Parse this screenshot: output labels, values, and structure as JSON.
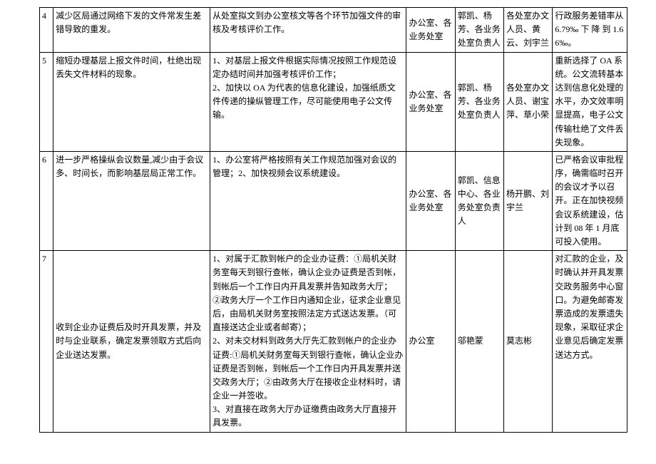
{
  "rows": [
    {
      "num": "4",
      "problem": "减少区局通过网络下发的文件常发生差错导致的重发。",
      "measure": "从处室拟文到办公室核文等各个环节加强文件的审核及考核评价工作。",
      "dept1": "办公室、各业务处室",
      "dept2": "郭凯、杨芳、各业务处室负责人",
      "dept3": "各处室办文人员、黄云、刘宇兰",
      "remark": "行政服务差错率从 6.79‰ 下 降 到 1.66‰。"
    },
    {
      "num": "5",
      "problem": "缩短办理基层上报文件时间，杜绝出现丢失文件材料的现象。",
      "measure": "1、对基层上报文件根据实际情况按照工作规范设定办结时间并加强考核评价工作；\n2、加快以 OA 为代表的信息化建设，加强纸质文件传递的操纵管理工作，尽可能使用电子公文传输。",
      "dept1": "办公室、各业务处室",
      "dept2": "郭凯、杨芳、各业务处室负责人",
      "dept3": "各处室办文人员、谢宝萍、草小荣",
      "remark": "重新选择了 OA 系统。公文流转基本达到信息化处理的水平，办文效率明显提高，电子公文传输杜绝了文件丢失现象。"
    },
    {
      "num": "6",
      "problem": "进一步严格操纵会议数量,减少由于会议多、时间长，而影响基层局正常工作。",
      "measure": "1、办公室将严格按照有关工作规范加强对会议的管理；2、加快视频会议系统建设。",
      "dept1": "办公室、各业务处室",
      "dept2": "郭凯、信息中心、各业务处室负责人",
      "dept3": "杨开鹏、刘宇兰",
      "remark": "已严格会议审批程序，确需临时召开的会议才予以召开。正在加快视频会议系统建设，估计到 08 年 1 月底可投入使用。"
    },
    {
      "num": "7",
      "problem": "收到企业办证费后及时开具发票，并及时与企业联系，确定发票领取方式后向企业送达发票。",
      "measure": "1、对属于汇款到帐户的企业办证费：①局机关财务室每天到银行查帐，确认企业办证费是否到帐，到帐后一个工作日内开具发票并告知政务大厅；\n②政务大厅一个工作日内通知企业，征求企业意见后，由局机关财务室按照法定方式送达发票。（可直接送达企业或者邮寄）；\n2、对未交材料到政务大厅先汇款到帐户的企业办证费:①局机关财务室每天到银行查帐，确认企业办证费是否到帐，到帐后一个工作日内开具发票并送交政务大厅；②由政务大厅在接收企业材料时，请企业一并签收。\n3、对直接在政务大厅办证缴费由政务大厅直接开具发票。",
      "dept1": "办公室",
      "dept2": "邬艳蒙",
      "dept3": "莫志彬",
      "remark": "对汇款的企业，及时确认并开具发票交政务服务中心窗口。为避免邮寄发票造成的发票遗失现象，采取征求企业意见后确定发票送达方式。"
    }
  ]
}
